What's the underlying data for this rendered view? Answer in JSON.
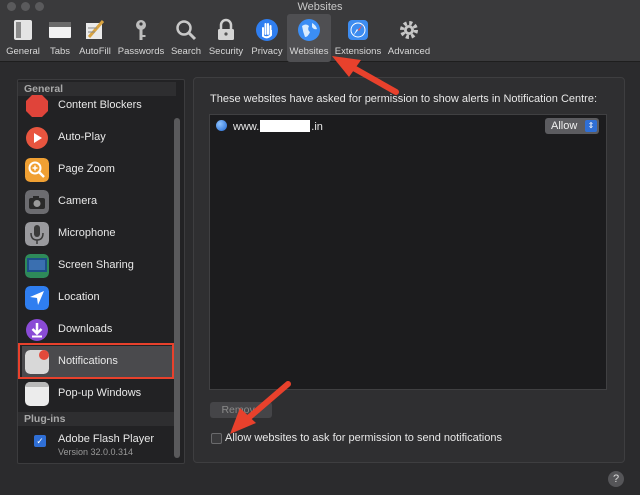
{
  "window": {
    "title": "Websites"
  },
  "toolbar": {
    "items": [
      {
        "label": "General",
        "icon": "general-icon"
      },
      {
        "label": "Tabs",
        "icon": "tabs-icon"
      },
      {
        "label": "AutoFill",
        "icon": "autofill-icon"
      },
      {
        "label": "Passwords",
        "icon": "key-icon"
      },
      {
        "label": "Search",
        "icon": "search-icon"
      },
      {
        "label": "Security",
        "icon": "lock-icon"
      },
      {
        "label": "Privacy",
        "icon": "hand-icon"
      },
      {
        "label": "Websites",
        "icon": "globe-icon",
        "selected": true
      },
      {
        "label": "Extensions",
        "icon": "extensions-icon"
      },
      {
        "label": "Advanced",
        "icon": "gear-icon"
      }
    ]
  },
  "sidebar": {
    "general_heading": "General",
    "items": [
      {
        "label": "Content Blockers",
        "icon": "content-blockers-icon",
        "color": "#e0443a"
      },
      {
        "label": "Auto-Play",
        "icon": "autoplay-icon",
        "color": "#e8553f"
      },
      {
        "label": "Page Zoom",
        "icon": "page-zoom-icon",
        "color": "#f0a033"
      },
      {
        "label": "Camera",
        "icon": "camera-icon",
        "color": "#6c6c70"
      },
      {
        "label": "Microphone",
        "icon": "microphone-icon",
        "color": "#9a9a9e"
      },
      {
        "label": "Screen Sharing",
        "icon": "screen-sharing-icon",
        "color": "#2e8a5a"
      },
      {
        "label": "Location",
        "icon": "location-icon",
        "color": "#2f7ef0"
      },
      {
        "label": "Downloads",
        "icon": "downloads-icon",
        "color": "#8a4bd6"
      },
      {
        "label": "Notifications",
        "icon": "notifications-icon",
        "color": "#d8d8d8",
        "selected": true
      },
      {
        "label": "Pop-up Windows",
        "icon": "popup-windows-icon",
        "color": "#e8e8e8"
      }
    ],
    "plugins_heading": "Plug-ins",
    "plugin": {
      "label": "Adobe Flash Player",
      "version": "Version 32.0.0.314",
      "checked": true
    }
  },
  "main": {
    "description": "These websites have asked for permission to show alerts in Notification Centre:",
    "sites": [
      {
        "prefix": "www.",
        "suffix": ".in",
        "permission": "Allow"
      }
    ],
    "remove_button": "Remove",
    "allow_checkbox_label": "Allow websites to ask for permission to send notifications",
    "allow_checkbox_checked": false
  },
  "help": {
    "label": "?"
  },
  "colors": {
    "annotation": "#e8412c",
    "accent": "#2f6fd6"
  }
}
